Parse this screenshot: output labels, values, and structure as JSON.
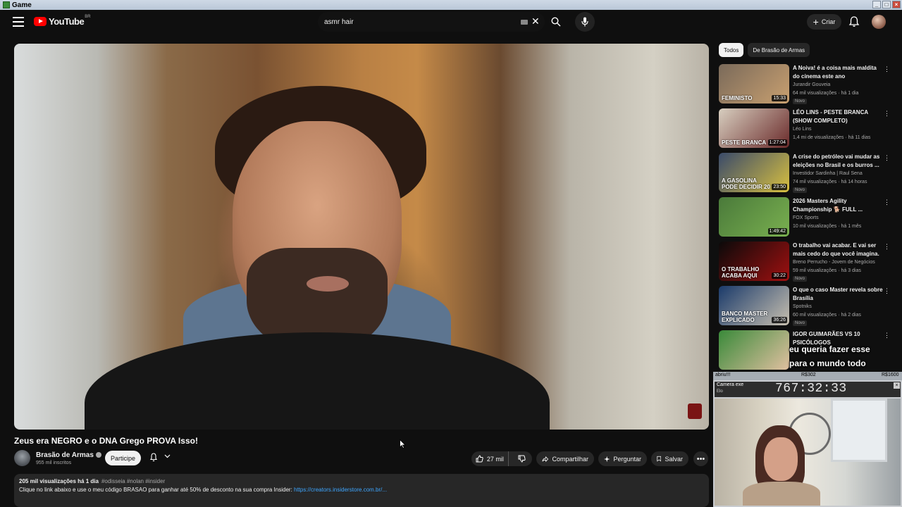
{
  "window": {
    "title": "Game"
  },
  "header": {
    "logo_text": "YouTube",
    "logo_country": "BR",
    "search_value": "asmr hair",
    "create_label": "Criar"
  },
  "video": {
    "title": "Zeus era NEGRO e o DNA Grego PROVA Isso!",
    "channel": "Brasão de Armas",
    "subscribers": "955 mil inscritos",
    "join_label": "Participe",
    "likes": "27 mil",
    "share_label": "Compartilhar",
    "ask_label": "Perguntar",
    "save_label": "Salvar"
  },
  "description": {
    "meta": "205 mil visualizações  há 1 dia",
    "tags": "#odisseia #nolan #insider",
    "text": "Clique no link abaixo e use o meu código BRASAO para ganhar até 50% de desconto na sua compra Insider: ",
    "link": "https://creators.insiderstore.com.br/..."
  },
  "chips": [
    "Todos",
    "De Brasão de Armas"
  ],
  "recommendations": [
    {
      "title": "A Noiva! é a coisa mais maldita do cinema este ano",
      "channel": "Jurandir Gouveia",
      "views": "64 mil visualizações · há 1 dia",
      "duration": "15:33",
      "badge": "Novo",
      "thumb_overlay": "FEMINISTO",
      "thumb_colors": [
        "#7a6a5a",
        "#c9a070"
      ]
    },
    {
      "title": "LÉO LINS - PESTE BRANCA (SHOW COMPLETO)",
      "channel": "Léo Lins",
      "views": "1,4 mi de visualizações · há 11 dias",
      "duration": "1:27:04",
      "badge": "",
      "thumb_overlay": "PESTE BRANCA",
      "thumb_colors": [
        "#d8cfc0",
        "#6a2a2a"
      ]
    },
    {
      "title": "A crise do petróleo vai mudar as eleições no Brasil e os burros ...",
      "channel": "Investidor Sardinha | Raul Sena",
      "views": "74 mil visualizações · há 14 horas",
      "duration": "23:50",
      "badge": "Novo",
      "thumb_overlay": "A GASOLINA PODE DECIDIR 20",
      "thumb_colors": [
        "#3a4a6a",
        "#d8c040"
      ]
    },
    {
      "title": "2026 Masters Agility Championship 🐕 FULL ...",
      "channel": "FOX Sports",
      "views": "10 mil visualizações · há 1 mês",
      "duration": "1:49:42",
      "badge": "",
      "thumb_overlay": "",
      "thumb_colors": [
        "#4a7a3a",
        "#7ab050"
      ]
    },
    {
      "title": "O trabalho vai acabar. E vai ser mais cedo do que você imagina.",
      "channel": "Breno Perrucho - Jovem de Negócios",
      "views": "59 mil visualizações · há 3 dias",
      "duration": "30:22",
      "badge": "Novo",
      "thumb_overlay": "O TRABALHO ACABA AQUI",
      "thumb_colors": [
        "#0a0a0a",
        "#a01010"
      ]
    },
    {
      "title": "O que o caso Master revela sobre Brasília",
      "channel": "Spotniks",
      "views": "60 mil visualizações · há 2 dias",
      "duration": "36:26",
      "badge": "Novo",
      "thumb_overlay": "BANCO MASTER EXPLICADO",
      "thumb_colors": [
        "#1a3a6a",
        "#c8c0b0"
      ]
    },
    {
      "title": "IGOR GUIMARÃES VS 10 PSICÓLOGOS",
      "channel": "",
      "views": "",
      "duration": "",
      "badge": "",
      "thumb_overlay": "",
      "thumb_colors": [
        "#3a8a3a",
        "#e0c0a0"
      ]
    }
  ],
  "subtitle_overlay": {
    "line1": "eu queria fazer esse",
    "line2": "para o mundo todo"
  },
  "overlay": {
    "header_left": "abriu!!!",
    "header_mid": "R$302",
    "header_right": "R$1600",
    "camera_label": "Camera exe",
    "camera_sub": "Elo",
    "timer": "767:32:33"
  }
}
